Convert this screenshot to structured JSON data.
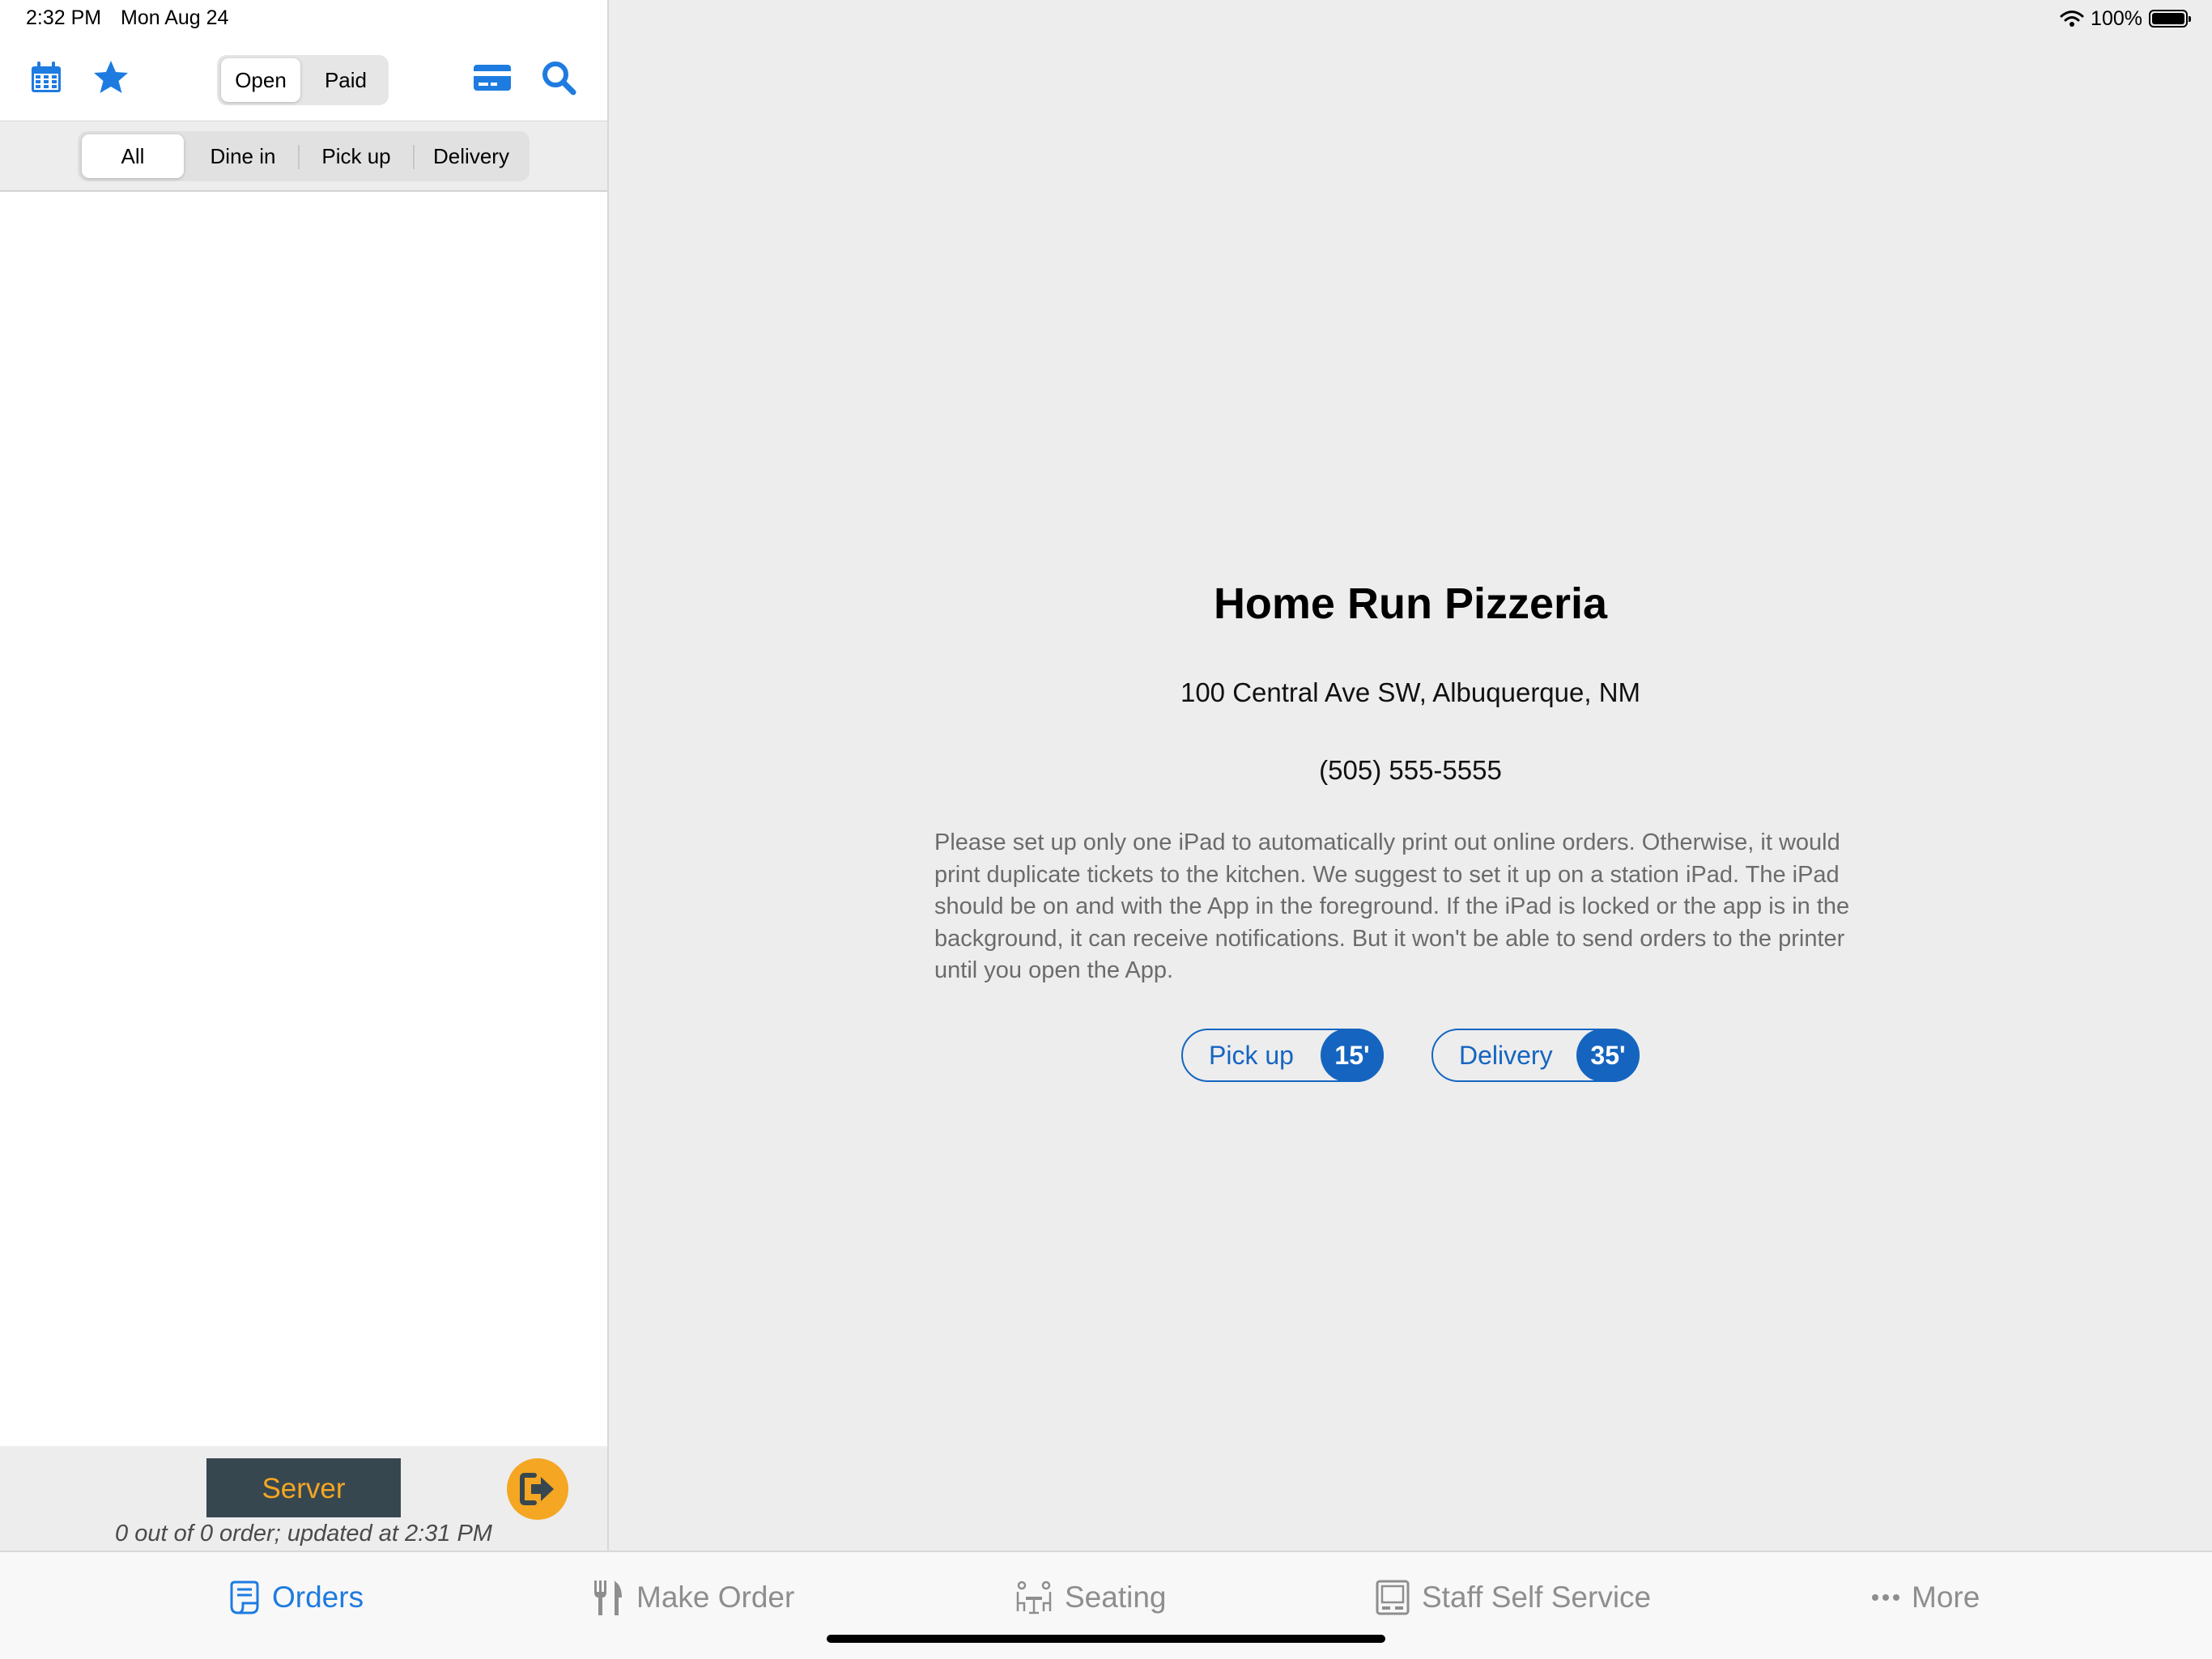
{
  "status_bar": {
    "time": "2:32 PM",
    "date": "Mon Aug 24",
    "battery": "100%"
  },
  "toolbar": {
    "icons": [
      "calendar-icon",
      "star-icon",
      "credit-card-icon",
      "search-icon"
    ],
    "segments": [
      {
        "label": "Open",
        "selected": true
      },
      {
        "label": "Paid",
        "selected": false
      }
    ]
  },
  "filters": [
    {
      "label": "All",
      "selected": true
    },
    {
      "label": "Dine in",
      "selected": false
    },
    {
      "label": "Pick up",
      "selected": false
    },
    {
      "label": "Delivery",
      "selected": false
    }
  ],
  "footer": {
    "server_label": "Server",
    "status_text": "0 out of 0 order; updated at 2:31 PM",
    "logout_icon": "logout-icon"
  },
  "restaurant": {
    "name": "Home Run Pizzeria",
    "address": "100 Central Ave SW, Albuquerque, NM",
    "phone": "(505) 555-5555",
    "notice": "Please set up only one iPad to automatically print out online orders. Otherwise, it would print duplicate tickets to the kitchen. We suggest to set it up on a station iPad. The iPad should be on and with the App in the foreground. If the iPad is locked or the app is in the background, it can receive notifications. But it won't be able to send orders to the printer until you open the App."
  },
  "order_times": {
    "pickup": {
      "label": "Pick up",
      "minutes": "15'"
    },
    "delivery": {
      "label": "Delivery",
      "minutes": "35'"
    }
  },
  "tabs": [
    {
      "label": "Orders",
      "icon": "receipt-icon",
      "active": true
    },
    {
      "label": "Make Order",
      "icon": "fork-knife-icon",
      "active": false
    },
    {
      "label": "Seating",
      "icon": "table-seating-icon",
      "active": false
    },
    {
      "label": "Staff Self Service",
      "icon": "monitor-icon",
      "active": false
    },
    {
      "label": "More",
      "icon": "ellipsis-icon",
      "active": false
    }
  ],
  "colors": {
    "accent_blue": "#1e7be0",
    "pill_blue": "#1565c0",
    "server_bg": "#37474f",
    "orange": "#f5a623",
    "background": "#ededed"
  }
}
